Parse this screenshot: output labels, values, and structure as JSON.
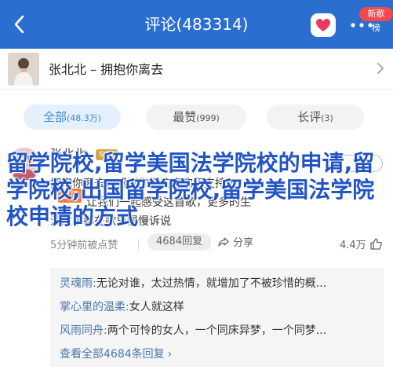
{
  "header": {
    "title": "评论(483314)",
    "badge": "新歌榜"
  },
  "song": {
    "title": "张北北 – 拥抱你离去"
  },
  "tabs": [
    {
      "label": "全部",
      "count": "(48.3万)",
      "active": true
    },
    {
      "label": "最赞",
      "count": "(999)",
      "active": false
    },
    {
      "label": "长评",
      "count": "(3)",
      "active": false
    }
  ],
  "comment": {
    "username": "张北北",
    "vip": "SVIP",
    "follow_label": "关注",
    "tag": "置顶",
    "line1": "拥抱你离去！感谢你们的喜欢和支持～",
    "line2": "让我们一起感受这首歌，更多的生",
    "line3": "活故事都在歌里慢慢诉说",
    "overlay": "留学院校,留学美国法学院校的申请,留学院校,出国留学院校,留学美国法学院校申请的方式",
    "time": "5分钟前被点赞",
    "reply_count": "4684回复",
    "share": "分享",
    "likes": "4.4万"
  },
  "replies": [
    {
      "user": "灵魂雨:",
      "text": "无论对谁，太过热情，就增加了不被珍惜的概..."
    },
    {
      "user": "掌心里的温柔:",
      "text": "女人就这样"
    },
    {
      "user": "风雨同舟:",
      "text": "两个可怜的女人，一个同床异梦，一个同梦..."
    }
  ],
  "view_all": "查看全部4684条回复",
  "colors": {
    "header_bg": "#2a6fd0",
    "accent": "#3a86d6",
    "badge": "#f04a4a",
    "link": "#4a76ad",
    "overlay_text": "#2254c4"
  }
}
